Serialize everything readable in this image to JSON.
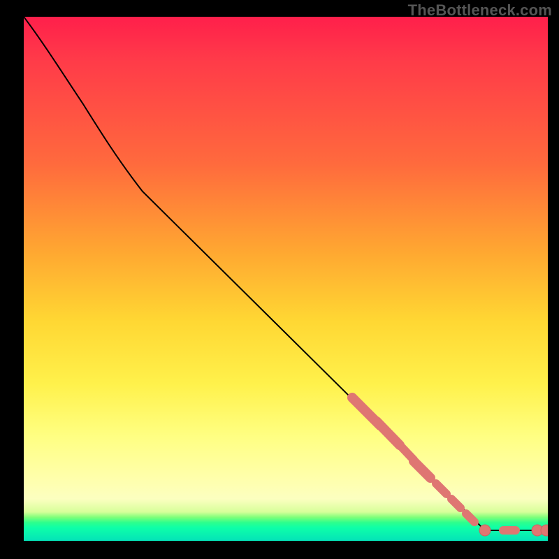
{
  "watermark": "TheBottleneck.com",
  "colors": {
    "gradient_top": "#ff1f4b",
    "gradient_mid": "#ffe84a",
    "gradient_bottom": "#04e3b8",
    "curve": "#000000",
    "marker": "#df7672",
    "frame": "#000000"
  },
  "chart_data": {
    "type": "line",
    "title": "",
    "xlabel": "",
    "ylabel": "",
    "xlim": [
      0,
      100
    ],
    "ylim": [
      0,
      100
    ],
    "series": [
      {
        "name": "bottleneck-curve",
        "x": [
          0,
          4,
          8,
          12,
          16,
          22,
          30,
          40,
          50,
          60,
          70,
          80,
          88,
          92,
          96,
          100
        ],
        "y": [
          100,
          95,
          89,
          83,
          77,
          68,
          57,
          46,
          35,
          25,
          15,
          6,
          2,
          2,
          2,
          2
        ]
      }
    ],
    "markers": {
      "name": "highlighted-range",
      "color": "#df7672",
      "points": [
        {
          "x": 63,
          "y": 27
        },
        {
          "x": 68,
          "y": 22
        },
        {
          "x": 72,
          "y": 18
        },
        {
          "x": 75,
          "y": 15
        },
        {
          "x": 78,
          "y": 12
        },
        {
          "x": 81,
          "y": 9
        },
        {
          "x": 84,
          "y": 6
        },
        {
          "x": 86,
          "y": 4
        },
        {
          "x": 88,
          "y": 2
        },
        {
          "x": 92,
          "y": 2
        },
        {
          "x": 94,
          "y": 2
        },
        {
          "x": 98,
          "y": 2
        },
        {
          "x": 100,
          "y": 2
        }
      ]
    },
    "background_gradient": {
      "orientation": "vertical",
      "stops": [
        {
          "pos": 0.0,
          "color": "#ff1f4b"
        },
        {
          "pos": 0.45,
          "color": "#ffa831"
        },
        {
          "pos": 0.7,
          "color": "#fff14b"
        },
        {
          "pos": 0.92,
          "color": "#fcffc0"
        },
        {
          "pos": 0.96,
          "color": "#2dff8d"
        },
        {
          "pos": 1.0,
          "color": "#04e3b8"
        }
      ]
    }
  }
}
